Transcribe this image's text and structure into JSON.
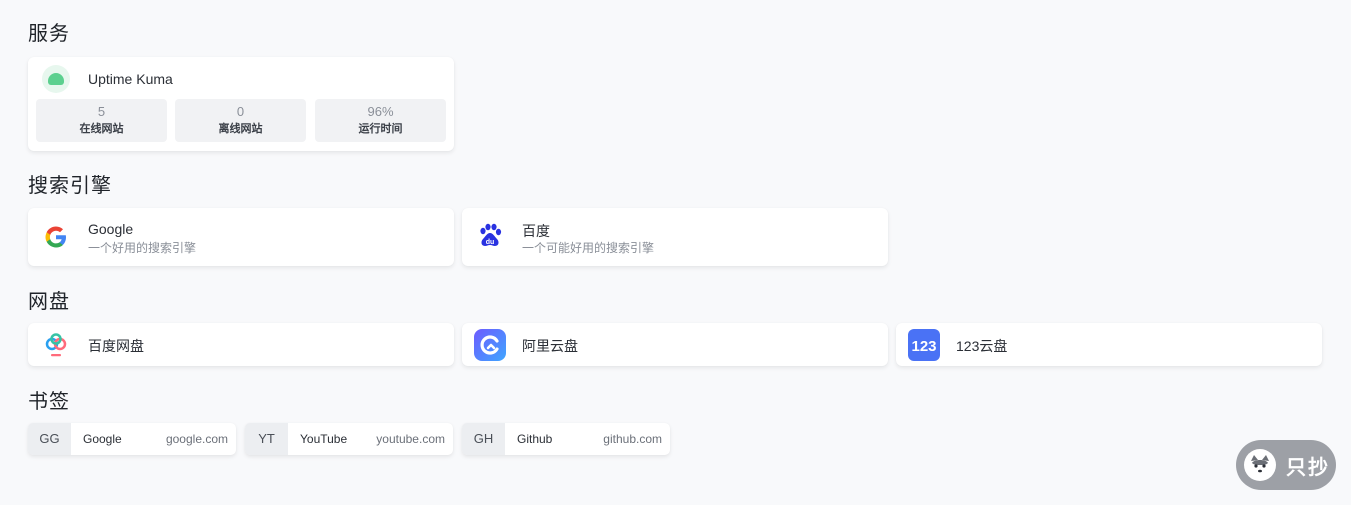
{
  "sections": {
    "services": "服务",
    "search": "搜索引擎",
    "drive": "网盘",
    "bookmarks": "书签"
  },
  "uptime": {
    "name": "Uptime Kuma",
    "stats": [
      {
        "value": "5",
        "label": "在线网站"
      },
      {
        "value": "0",
        "label": "离线网站"
      },
      {
        "value": "96%",
        "label": "运行时间"
      }
    ],
    "icon": "uptime-kuma-icon"
  },
  "search_engines": [
    {
      "name": "Google",
      "desc": "一个好用的搜索引擎",
      "icon": "google-icon"
    },
    {
      "name": "百度",
      "desc": "一个可能好用的搜索引擎",
      "icon": "baidu-icon"
    }
  ],
  "drives": [
    {
      "name": "百度网盘",
      "icon": "baidu-netdisk-icon"
    },
    {
      "name": "阿里云盘",
      "icon": "aliyun-drive-icon"
    },
    {
      "name": "123云盘",
      "icon": "123pan-icon",
      "icon_text": "123"
    }
  ],
  "bookmarks": [
    {
      "abbr": "GG",
      "name": "Google",
      "url": "google.com"
    },
    {
      "abbr": "YT",
      "name": "YouTube",
      "url": "youtube.com"
    },
    {
      "abbr": "GH",
      "name": "Github",
      "url": "github.com"
    }
  ],
  "badge": {
    "text": "只抄"
  },
  "colors": {
    "background": "#f8f9fb",
    "card": "#ffffff",
    "uptime_green": "#5cd08f",
    "baidu_blue": "#2932e1",
    "aliyun_blue": "#5b6bff",
    "pan123_blue": "#4a72f5"
  }
}
